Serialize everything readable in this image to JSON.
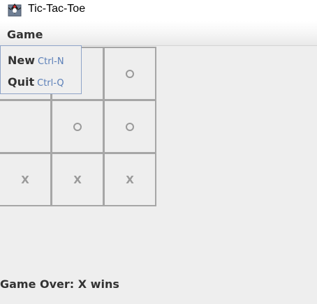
{
  "window": {
    "title": "Tic-Tac-Toe",
    "icon": "duke-mascot-icon"
  },
  "menubar": {
    "items": [
      {
        "label": "Game"
      }
    ]
  },
  "game_menu": {
    "open": true,
    "items": [
      {
        "label": "New",
        "accelerator": "Ctrl-N"
      },
      {
        "label": "Quit",
        "accelerator": "Ctrl-Q"
      }
    ]
  },
  "board": {
    "size": 3,
    "cells": [
      [
        "",
        "",
        "O"
      ],
      [
        "",
        "O",
        "O"
      ],
      [
        "X",
        "X",
        "X"
      ]
    ]
  },
  "status": {
    "text": "Game Over: X wins"
  },
  "colors": {
    "background": "#eeeeee",
    "grid_border": "#a6a6a6",
    "mark": "#9a9a9a",
    "accelerator_text": "#5b7fb8",
    "menu_border": "#8fa4c8"
  }
}
